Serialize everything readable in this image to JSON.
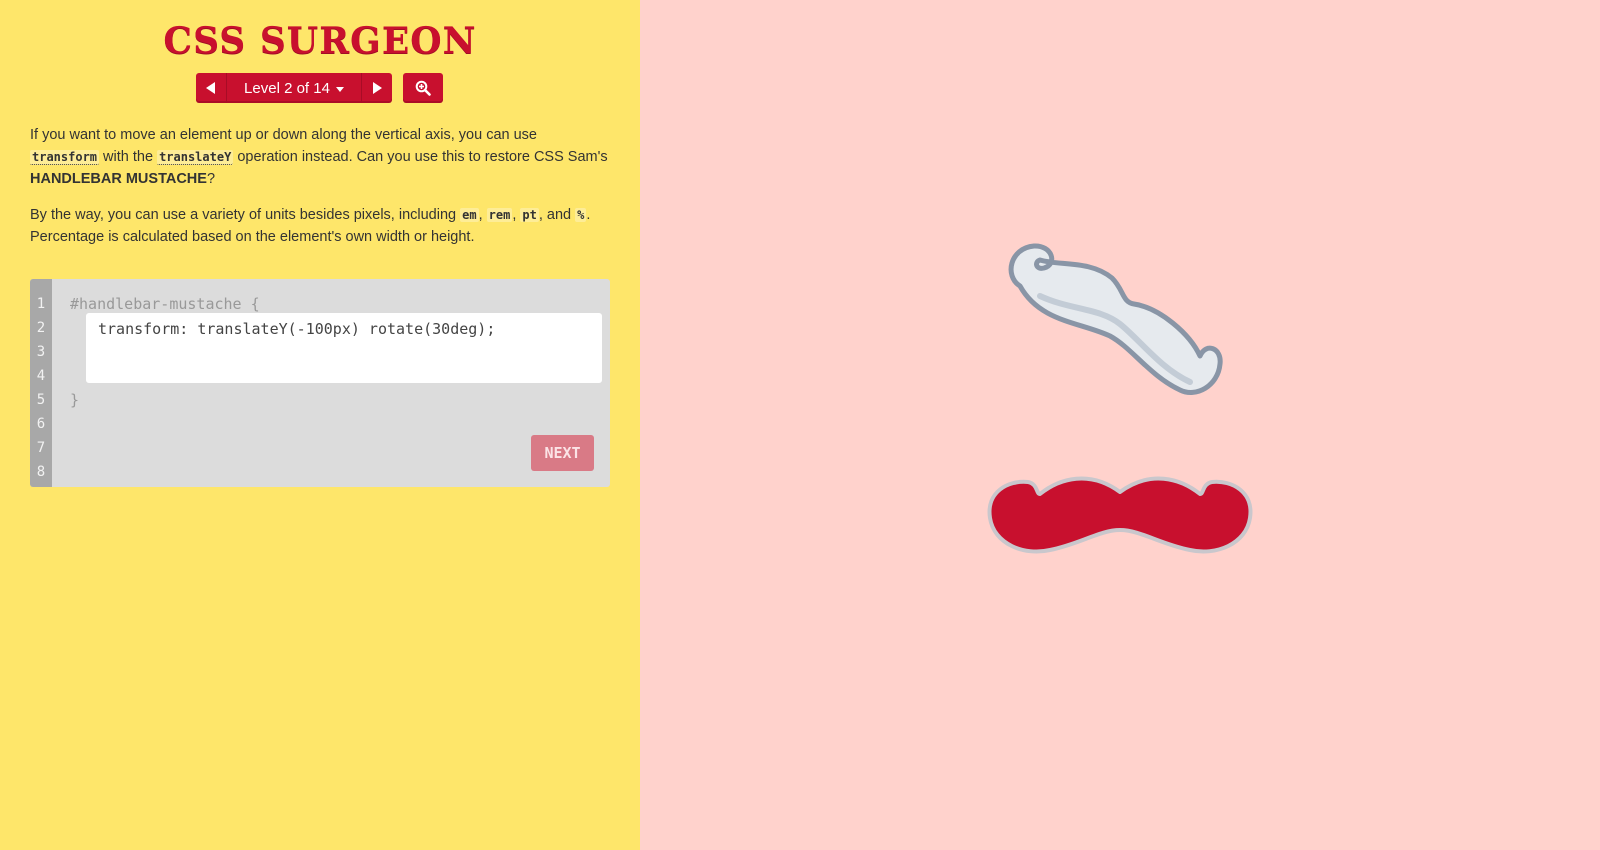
{
  "app": {
    "title": "CSS SURGEON"
  },
  "nav": {
    "level_label": "Level 2 of 14",
    "prev_icon": "triangle-left-icon",
    "next_icon": "triangle-right-icon",
    "zoom_icon": "zoom-in-icon"
  },
  "instructions": {
    "p1_a": "If you want to move an element up or down along the vertical axis, you can use ",
    "p1_code1": "transform",
    "p1_b": " with the ",
    "p1_code2": "translateY",
    "p1_c": " operation instead. Can you use this to restore CSS Sam's ",
    "p1_strong": "HANDLEBAR MUSTACHE",
    "p1_d": "?",
    "p2_a": "By the way, you can use a variety of units besides pixels, including ",
    "p2_code1": "em",
    "p2_sep1": ", ",
    "p2_code2": "rem",
    "p2_sep2": ", ",
    "p2_code3": "pt",
    "p2_sep3": ", and ",
    "p2_code4": "%",
    "p2_b": ". Percentage is calculated based on the element's own width or height."
  },
  "editor": {
    "line_numbers": [
      "1",
      "2",
      "3",
      "4",
      "5",
      "6",
      "7",
      "8"
    ],
    "selector_line": "#handlebar-mustache {",
    "input_value": "transform: translateY(-100px) rotate(30deg);",
    "closing_line": "}",
    "next_label": "NEXT"
  },
  "colors": {
    "panel_bg": "#fee66a",
    "stage_bg": "#ffd2cc",
    "accent": "#c8102e",
    "ghost_mustache": "#e6eaee",
    "ghost_outline": "#8995a6"
  }
}
